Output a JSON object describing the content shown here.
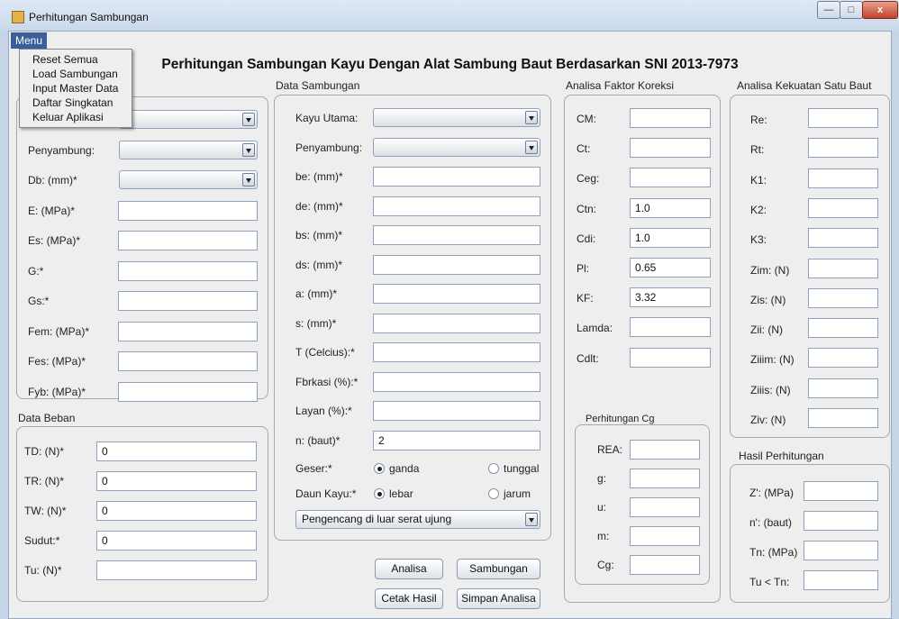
{
  "window": {
    "title": "Perhitungan Sambungan",
    "min_glyph": "—",
    "max_glyph": "□",
    "close_glyph": "x"
  },
  "menu": {
    "title": "Menu",
    "items": [
      "Reset Semua",
      "Load Sambungan",
      "Input Master Data",
      "Daftar Singkatan",
      "Keluar Aplikasi"
    ]
  },
  "page_title": "Perhitungan Sambungan Kayu Dengan Alat Sambung Baut Berdasarkan SNI 2013-7973",
  "panel1": {
    "fields": [
      {
        "label": "",
        "type": "combo",
        "value": ""
      },
      {
        "label": "Penyambung:",
        "type": "combo",
        "value": ""
      },
      {
        "label": "Db: (mm)*",
        "type": "combo",
        "value": ""
      },
      {
        "label": "E: (MPa)*",
        "type": "text",
        "value": ""
      },
      {
        "label": "Es: (MPa)*",
        "type": "text",
        "value": ""
      },
      {
        "label": "G:*",
        "type": "text",
        "value": ""
      },
      {
        "label": "Gs:*",
        "type": "text",
        "value": ""
      },
      {
        "label": "Fem: (MPa)*",
        "type": "text",
        "value": ""
      },
      {
        "label": "Fes: (MPa)*",
        "type": "text",
        "value": ""
      },
      {
        "label": "Fyb: (MPa)*",
        "type": "text",
        "value": ""
      }
    ]
  },
  "beban": {
    "title": "Data Beban",
    "fields": [
      {
        "label": "TD: (N)*",
        "value": "0"
      },
      {
        "label": "TR: (N)*",
        "value": "0"
      },
      {
        "label": "TW: (N)*",
        "value": "0"
      },
      {
        "label": "Sudut:*",
        "value": "0"
      },
      {
        "label": "Tu: (N)*",
        "value": ""
      }
    ]
  },
  "sambungan": {
    "title": "Data Sambungan",
    "fields": [
      {
        "label": "Kayu Utama:",
        "type": "combo",
        "value": ""
      },
      {
        "label": "Penyambung:",
        "type": "combo",
        "value": ""
      },
      {
        "label": "be: (mm)*",
        "type": "text",
        "value": ""
      },
      {
        "label": "de: (mm)*",
        "type": "text",
        "value": ""
      },
      {
        "label": "bs: (mm)*",
        "type": "text",
        "value": ""
      },
      {
        "label": "ds: (mm)*",
        "type": "text",
        "value": ""
      },
      {
        "label": "a: (mm)*",
        "type": "text",
        "value": ""
      },
      {
        "label": "s: (mm)*",
        "type": "text",
        "value": ""
      },
      {
        "label": "T (Celcius):*",
        "type": "text",
        "value": ""
      },
      {
        "label": "Fbrkasi (%):*",
        "type": "text",
        "value": ""
      },
      {
        "label": "Layan (%):*",
        "type": "text",
        "value": ""
      },
      {
        "label": "n: (baut)*",
        "type": "text",
        "value": "2"
      }
    ],
    "geser_label": "Geser:*",
    "geser_options": [
      {
        "label": "ganda",
        "selected": true
      },
      {
        "label": "tunggal",
        "selected": false
      }
    ],
    "daun_label": "Daun Kayu:*",
    "daun_options": [
      {
        "label": "lebar",
        "selected": true
      },
      {
        "label": "jarum",
        "selected": false
      }
    ],
    "pengencang": "Pengencang di luar serat ujung",
    "buttons": [
      "Analisa",
      "Sambungan",
      "Cetak Hasil",
      "Simpan Analisa"
    ]
  },
  "koreksi": {
    "title": "Analisa Faktor Koreksi",
    "fields": [
      {
        "label": "CM:",
        "value": ""
      },
      {
        "label": "Ct:",
        "value": ""
      },
      {
        "label": "Ceg:",
        "value": ""
      },
      {
        "label": "Ctn:",
        "value": "1.0"
      },
      {
        "label": "Cdi:",
        "value": "1.0"
      },
      {
        "label": "Pl:",
        "value": "0.65"
      },
      {
        "label": "KF:",
        "value": "3.32"
      },
      {
        "label": "Lamda:",
        "value": ""
      },
      {
        "label": "Cdlt:",
        "value": ""
      }
    ],
    "cg_title": "Perhitungan Cg",
    "cg_fields": [
      {
        "label": "REA:",
        "value": ""
      },
      {
        "label": "g:",
        "value": ""
      },
      {
        "label": "u:",
        "value": ""
      },
      {
        "label": "m:",
        "value": ""
      },
      {
        "label": "Cg:",
        "value": ""
      }
    ]
  },
  "kekuatan": {
    "title": "Analisa Kekuatan Satu Baut",
    "fields": [
      {
        "label": "Re:",
        "value": ""
      },
      {
        "label": "Rt:",
        "value": ""
      },
      {
        "label": "K1:",
        "value": ""
      },
      {
        "label": "K2:",
        "value": ""
      },
      {
        "label": "K3:",
        "value": ""
      },
      {
        "label": "Zim: (N)",
        "value": ""
      },
      {
        "label": "Zis: (N)",
        "value": ""
      },
      {
        "label": "Zii: (N)",
        "value": ""
      },
      {
        "label": "Ziiim: (N)",
        "value": ""
      },
      {
        "label": "Ziiis: (N)",
        "value": ""
      },
      {
        "label": "Ziv: (N)",
        "value": ""
      }
    ]
  },
  "hasil": {
    "title": "Hasil Perhitungan",
    "fields": [
      {
        "label": "Z': (MPa)",
        "value": ""
      },
      {
        "label": "n': (baut)",
        "value": ""
      },
      {
        "label": "Tn: (MPa)",
        "value": ""
      },
      {
        "label": "Tu < Tn:",
        "value": ""
      }
    ]
  }
}
